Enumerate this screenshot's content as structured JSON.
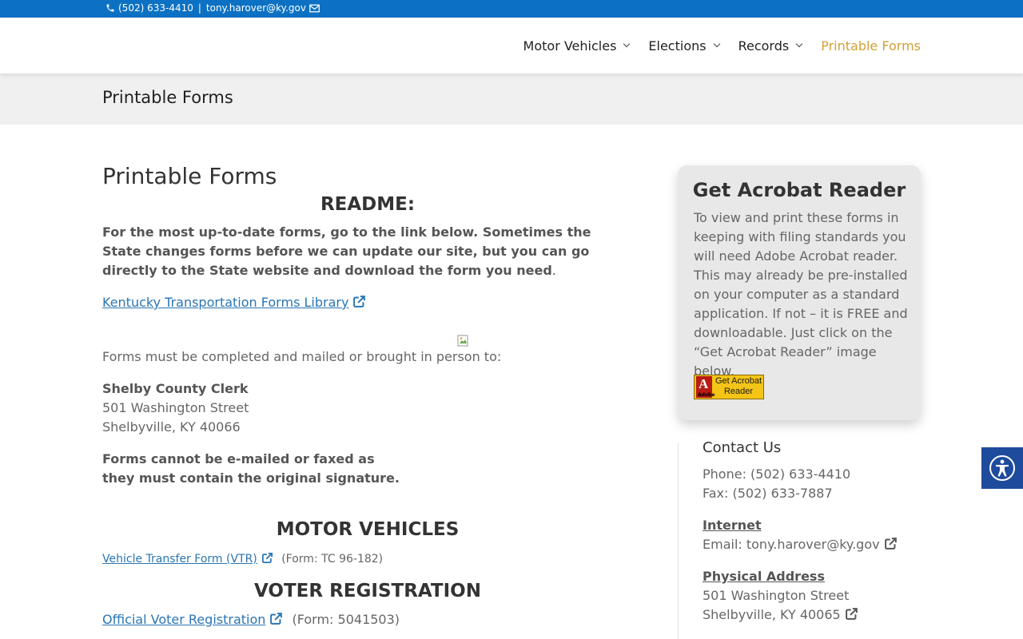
{
  "topbar": {
    "phone": "(502) 633-4410",
    "separator": "|",
    "email": "tony.harover@ky.gov",
    "phone_icon": "phone-icon",
    "mail_icon": "envelope-icon"
  },
  "nav": {
    "items": [
      {
        "label": "Motor Vehicles"
      },
      {
        "label": "Elections"
      },
      {
        "label": "Records"
      },
      {
        "label": "Printable Forms"
      }
    ],
    "active_color": "#d4a033"
  },
  "title_band": {
    "title": "Printable Forms"
  },
  "main": {
    "heading": "Printable Forms",
    "readme_heading": "README:",
    "readme_text": "For the most up-to-date forms, go to the link below.  Sometimes the State changes forms before we can update our site, but you can go directly to the State website and download the form you need",
    "readme_period": ".",
    "forms_library_link": "Kentucky Transportation Forms Library",
    "mail_instructions": "Forms must be completed and mailed or brought in person to:",
    "clerk_name": "Shelby County Clerk",
    "clerk_street": "501 Washington Street",
    "clerk_city": "Shelbyville, KY 40066",
    "notice_line1": "Forms cannot be e-mailed or faxed as",
    "notice_line2": "they must contain the original signature.",
    "motor_vehicles_heading": "MOTOR VEHICLES",
    "vtr_link": "Vehicle Transfer Form (VTR)",
    "vtr_form_no": "(Form: TC 96-182)",
    "voter_heading": "VOTER REGISTRATION",
    "voter_link": "Official Voter Registration",
    "voter_form_no": "(Form: 5041503)"
  },
  "acrobat": {
    "title": "Get Acrobat Reader",
    "text": "To view and print these forms in keeping with filing standards you will need Adobe Acrobat reader. This may already be pre-installed on your computer as a standard application. If not – it is FREE and downloadable. Just click on the “Get Acrobat Reader” image below.",
    "badge_line1": "Get Acrobat",
    "badge_line2": "Reader",
    "badge_logo_letter": "A",
    "badge_brand": "Adobe"
  },
  "contact": {
    "title": "Contact Us",
    "phone": "Phone: (502) 633-4410",
    "fax": "Fax: (502) 633-7887",
    "internet_heading": "Internet",
    "email": "Email: tony.harover@ky.gov",
    "address_heading": "Physical Address",
    "street": "501 Washington Street",
    "city": "Shelbyville, KY 40065"
  },
  "colors": {
    "topbar": "#0c71c3",
    "link": "#2a75b3",
    "accessibility_button": "#1e4b9c"
  }
}
